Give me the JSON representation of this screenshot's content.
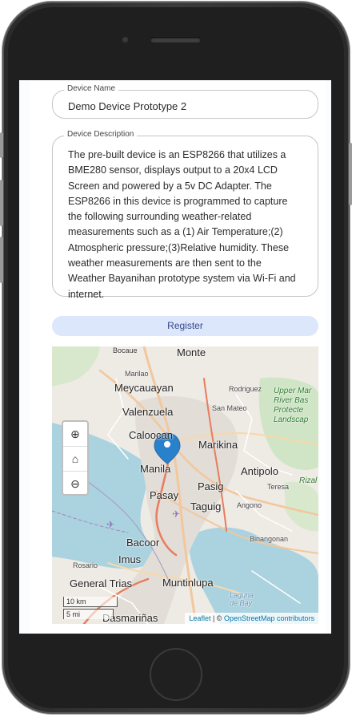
{
  "form": {
    "device_name_label": "Device Name",
    "device_name_value": "Demo Device Prototype 2",
    "device_description_label": "Device Description",
    "device_description_value": "The pre-built device is an ESP8266 that utilizes a BME280 sensor, displays output to a 20x4 LCD Screen and powered by a 5v DC Adapter. The ESP8266 in this device is programmed to capture the following surrounding weather-related measurements such as a (1) Air Temperature;(2) Atmospheric pressure;(3)Relative humidity. These weather measurements are then sent to the Weather Bayanihan prototype system via Wi-Fi and internet.",
    "register_label": "Register"
  },
  "map": {
    "labels": {
      "bocaue": "Bocaue",
      "monte": "Monte",
      "marilao": "Marilao",
      "meycauayan": "Meycauayan",
      "rodriguez": "Rodriguez",
      "upper_marikina": "Upper Mar\nRiver Bas\nProtecte\nLandscap",
      "valenzuela": "Valenzuela",
      "san_mateo": "San Mateo",
      "caloocan": "Caloocan",
      "marikina": "Marikina",
      "manila": "Manila",
      "antipolo": "Antipolo",
      "pasig": "Pasig",
      "teresa": "Teresa",
      "rizal": "Rizal",
      "pasay": "Pasay",
      "taguig": "Taguig",
      "angono": "Angono",
      "binangonan": "Binangonan",
      "bacoor": "Bacoor",
      "imus": "Imus",
      "rosario": "Rosario",
      "general_trias": "General Trias",
      "muntinlupa": "Muntinlupa",
      "laguna_de_bay": "Laguna\nde Bay",
      "dasmarinas": "Dasmariñas"
    },
    "controls": {
      "zoom_in": "⊕",
      "home": "⌂",
      "zoom_out": "⊖"
    },
    "scale_km": "10 km",
    "scale_mi": "5 mi",
    "attribution_leaflet": "Leaflet",
    "attribution_sep": " | © ",
    "attribution_osm": "OpenStreetMap contributors"
  }
}
